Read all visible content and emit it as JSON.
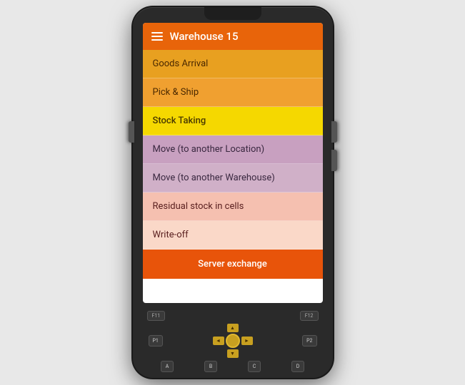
{
  "header": {
    "title": "Warehouse 15",
    "menu_icon": "☰"
  },
  "menu_items": [
    {
      "id": 1,
      "label": "Goods Arrival",
      "color_class": "menu-item-1"
    },
    {
      "id": 2,
      "label": "Pick & Ship",
      "color_class": "menu-item-2"
    },
    {
      "id": 3,
      "label": "Stock Taking",
      "color_class": "menu-item-3"
    },
    {
      "id": 4,
      "label": "Move (to another Location)",
      "color_class": "menu-item-4"
    },
    {
      "id": 5,
      "label": "Move (to another Warehouse)",
      "color_class": "menu-item-5"
    },
    {
      "id": 6,
      "label": "Residual stock in cells",
      "color_class": "menu-item-6"
    },
    {
      "id": 7,
      "label": "Write-off",
      "color_class": "menu-item-7"
    }
  ],
  "server_exchange_btn": "Server exchange",
  "keypad": {
    "fn_keys": [
      "F11",
      "F12"
    ],
    "p_keys": [
      "P1",
      "P2"
    ],
    "nav_arrows": [
      "▲",
      "◄",
      "►",
      "▼"
    ],
    "alpha_keys": [
      "A",
      "B",
      "C",
      "D"
    ]
  }
}
